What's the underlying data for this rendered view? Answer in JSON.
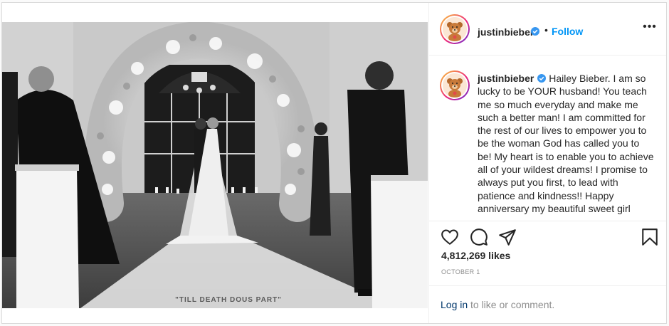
{
  "post": {
    "username": "justinbieber",
    "follow_label": "Follow",
    "separator": "•",
    "more_label": "•••",
    "caption_text": "Hailey Bieber. I am so lucky to be YOUR husband! You teach me so much everyday and make me such a better man! I am committed for the rest of our lives to empower you to be the woman God has called you to be! My heart is to enable you to achieve all of your wildest dreams! I promise to always put you first, to lead with patience and kindness!! Happy anniversary my beautiful sweet girl",
    "likes": "4,812,269 likes",
    "date": "OCTOBER 1",
    "login_link": "Log in",
    "login_rest": "to like or comment."
  },
  "photo": {
    "veil_text": "\"TILL DEATH DOUS PART\""
  },
  "icons": {
    "verified": "verified-badge-icon",
    "like": "heart-icon",
    "comment": "comment-bubble-icon",
    "share": "paper-plane-icon",
    "save": "bookmark-icon",
    "more": "more-options-icon"
  },
  "colors": {
    "follow_blue": "#0095f6",
    "verified_blue": "#3897f0",
    "login_link": "#00376b",
    "muted_text": "#8e8e8e",
    "border": "#dbdbdb"
  }
}
